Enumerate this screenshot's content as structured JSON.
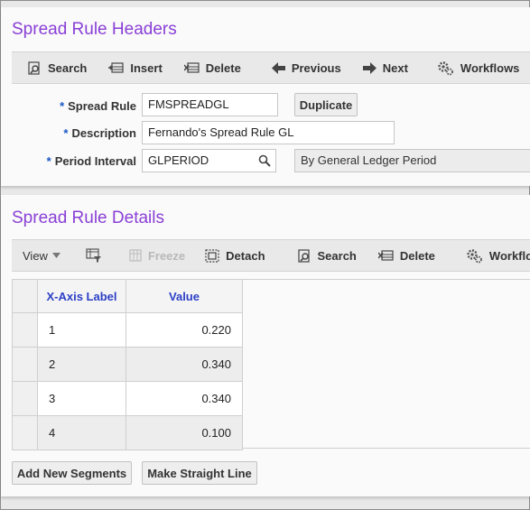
{
  "header_panel": {
    "title": "Spread Rule Headers",
    "toolbar": {
      "search": "Search",
      "insert": "Insert",
      "delete": "Delete",
      "previous": "Previous",
      "next": "Next",
      "workflows": "Workflows"
    },
    "fields": {
      "required_mark": "*",
      "spread_rule_label": "Spread Rule",
      "spread_rule_value": "FMSPREADGL",
      "duplicate_button": "Duplicate",
      "description_label": "Description",
      "description_value": "Fernando's Spread Rule GL",
      "period_interval_label": "Period Interval",
      "period_interval_value": "GLPERIOD",
      "period_interval_description": "By General Ledger Period"
    }
  },
  "details_panel": {
    "title": "Spread Rule Details",
    "toolbar": {
      "view": "View",
      "freeze": "Freeze",
      "detach": "Detach",
      "search": "Search",
      "delete": "Delete",
      "workflows": "Workflows"
    },
    "grid": {
      "columns": [
        "X-Axis Label",
        "Value"
      ],
      "rows": [
        {
          "label": "1",
          "value": "0.220"
        },
        {
          "label": "2",
          "value": "0.340"
        },
        {
          "label": "3",
          "value": "0.340"
        },
        {
          "label": "4",
          "value": "0.100"
        }
      ]
    },
    "buttons": {
      "add_segments": "Add New Segments",
      "straight_line": "Make Straight Line"
    }
  },
  "colors": {
    "title": "#8a3fd6",
    "grid_header_text": "#2c3fc7",
    "required_mark": "#1a56c8"
  }
}
